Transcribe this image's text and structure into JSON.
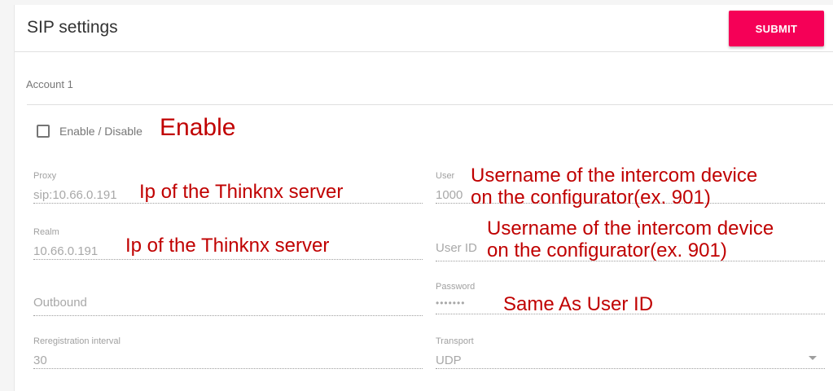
{
  "header": {
    "title": "SIP settings",
    "submit_label": "SUBMIT",
    "submit_color": "#f50057"
  },
  "tabs": [
    {
      "label": "Account 1"
    }
  ],
  "enable": {
    "label": "Enable / Disable",
    "checked": false
  },
  "fields": {
    "proxy": {
      "label": "Proxy",
      "value": "sip:10.66.0.191"
    },
    "user": {
      "label": "User",
      "value": "1000"
    },
    "realm": {
      "label": "Realm",
      "value": "10.66.0.191"
    },
    "user_id": {
      "label": "",
      "value": "User ID"
    },
    "outbound": {
      "label": "",
      "value": "Outbound"
    },
    "password": {
      "label": "Password",
      "value": "•••••••"
    },
    "reregistration": {
      "label": "Reregistration interval",
      "value": "30"
    },
    "transport": {
      "label": "Transport",
      "value": "UDP"
    }
  },
  "annotations": {
    "enable": "Enable",
    "proxy": "Ip of the Thinknx server",
    "user_line1": "Username of the intercom device",
    "user_line2": "on the configurator(ex. 901)",
    "realm": "Ip of the Thinknx server",
    "userid_line1": "Username of the intercom device",
    "userid_line2": "on the configurator(ex. 901)",
    "password": "Same As User ID",
    "color": "#c00000"
  }
}
